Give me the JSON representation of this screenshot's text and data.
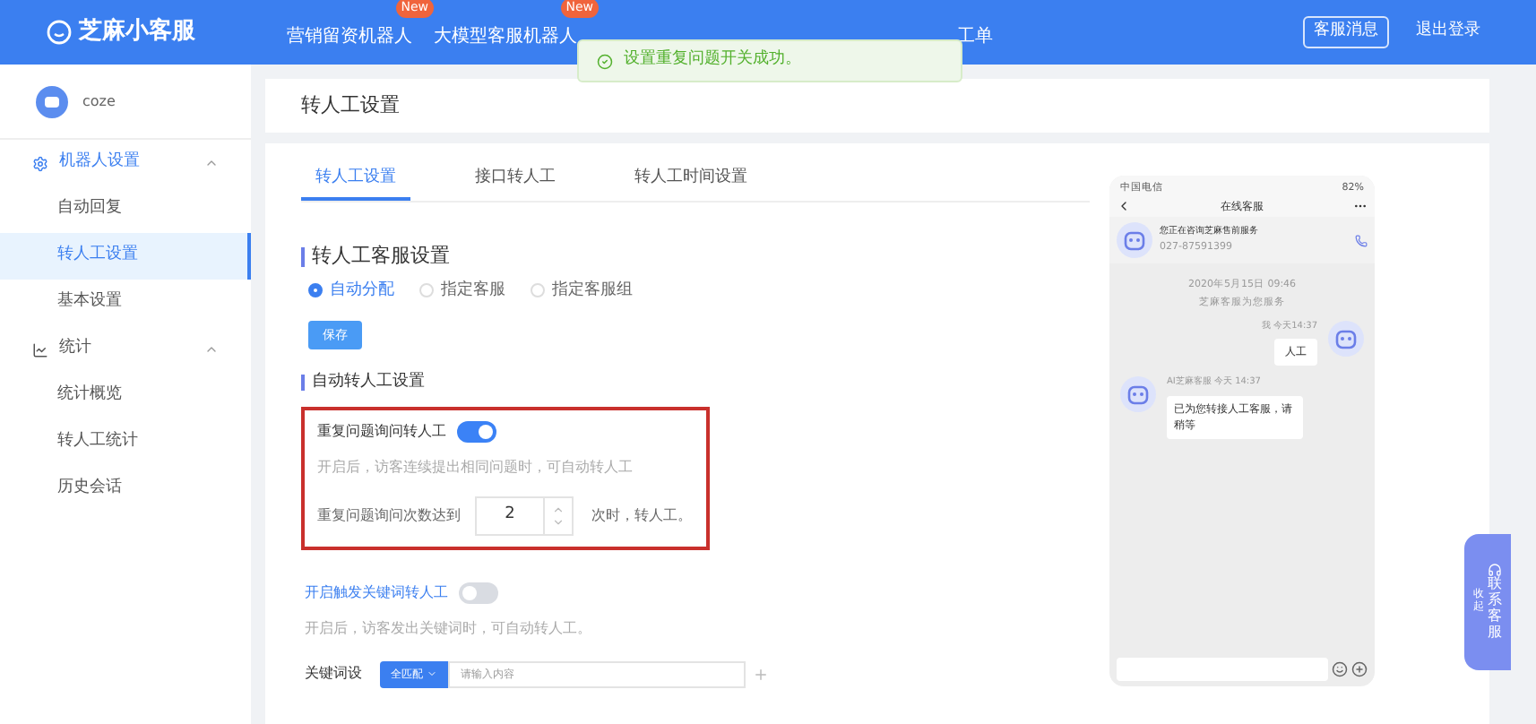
{
  "header": {
    "logo": "芝麻小客服",
    "nav": [
      {
        "label": "营销留资机器人",
        "badge": "New"
      },
      {
        "label": "大模型客服机器人",
        "badge": "New"
      },
      {
        "label": "工单"
      }
    ],
    "toast": "设置重复问题开关成功。",
    "buttons": [
      "客服消息",
      "退出登录"
    ]
  },
  "sidebar": {
    "bot_name": "coze",
    "menu": [
      {
        "label": "机器人设置",
        "kind": "gear",
        "expanded": true,
        "children": [
          {
            "label": "自动回复",
            "selected": false
          },
          {
            "label": "转人工设置",
            "selected": true
          },
          {
            "label": "基本设置",
            "selected": false
          }
        ]
      },
      {
        "label": "统计",
        "kind": "chart",
        "expanded": true,
        "children": [
          {
            "label": "统计概览",
            "selected": false
          },
          {
            "label": "转人工统计",
            "selected": false
          },
          {
            "label": "历史会话",
            "selected": false
          }
        ]
      }
    ]
  },
  "page_title": "转人工设置",
  "tabs": [
    {
      "label": "转人工设置",
      "selected": true
    },
    {
      "label": "接口转人工",
      "selected": false
    },
    {
      "label": "转人工时间设置",
      "selected": false
    }
  ],
  "service_section": {
    "title": "转人工客服设置",
    "radios": [
      {
        "label": "自动分配",
        "selected": true
      },
      {
        "label": "指定客服",
        "selected": false
      },
      {
        "label": "指定客服组",
        "selected": false
      }
    ],
    "save": "保存"
  },
  "auto_section": {
    "title": "自动转人工设置",
    "repeat": {
      "label": "重复问题询问转人工",
      "on": true,
      "hint": "开启后，访客连续提出相同问题时，可自动转人工",
      "count_label": "重复问题询问次数达到",
      "count": "2",
      "count_suffix": "次时，转人工。"
    },
    "keyword": {
      "label": "开启触发关键词转人工",
      "on": false,
      "hint": "开启后，访客发出关键词时，可自动转人工。",
      "field_label": "关键词设",
      "match": "全匹配",
      "placeholder": "请输入内容"
    }
  },
  "phone": {
    "carrier": "中国电信",
    "battery": "82%",
    "title": "在线客服",
    "contact_name": "您正在咨询芝麻售前服务",
    "contact_phone": "027-87591399",
    "date": "2020年5月15日 09:46",
    "service_note": "芝麻客服为您服务",
    "messages": [
      {
        "kind": "user",
        "meta": "我 今天14:37",
        "text": "人工"
      },
      {
        "kind": "bot",
        "meta": "AI芝麻客服 今天 14:37",
        "text": "已为您转接人工客服，请稍等"
      }
    ]
  },
  "float": {
    "collapse": "收起",
    "contact": "联系客服"
  }
}
